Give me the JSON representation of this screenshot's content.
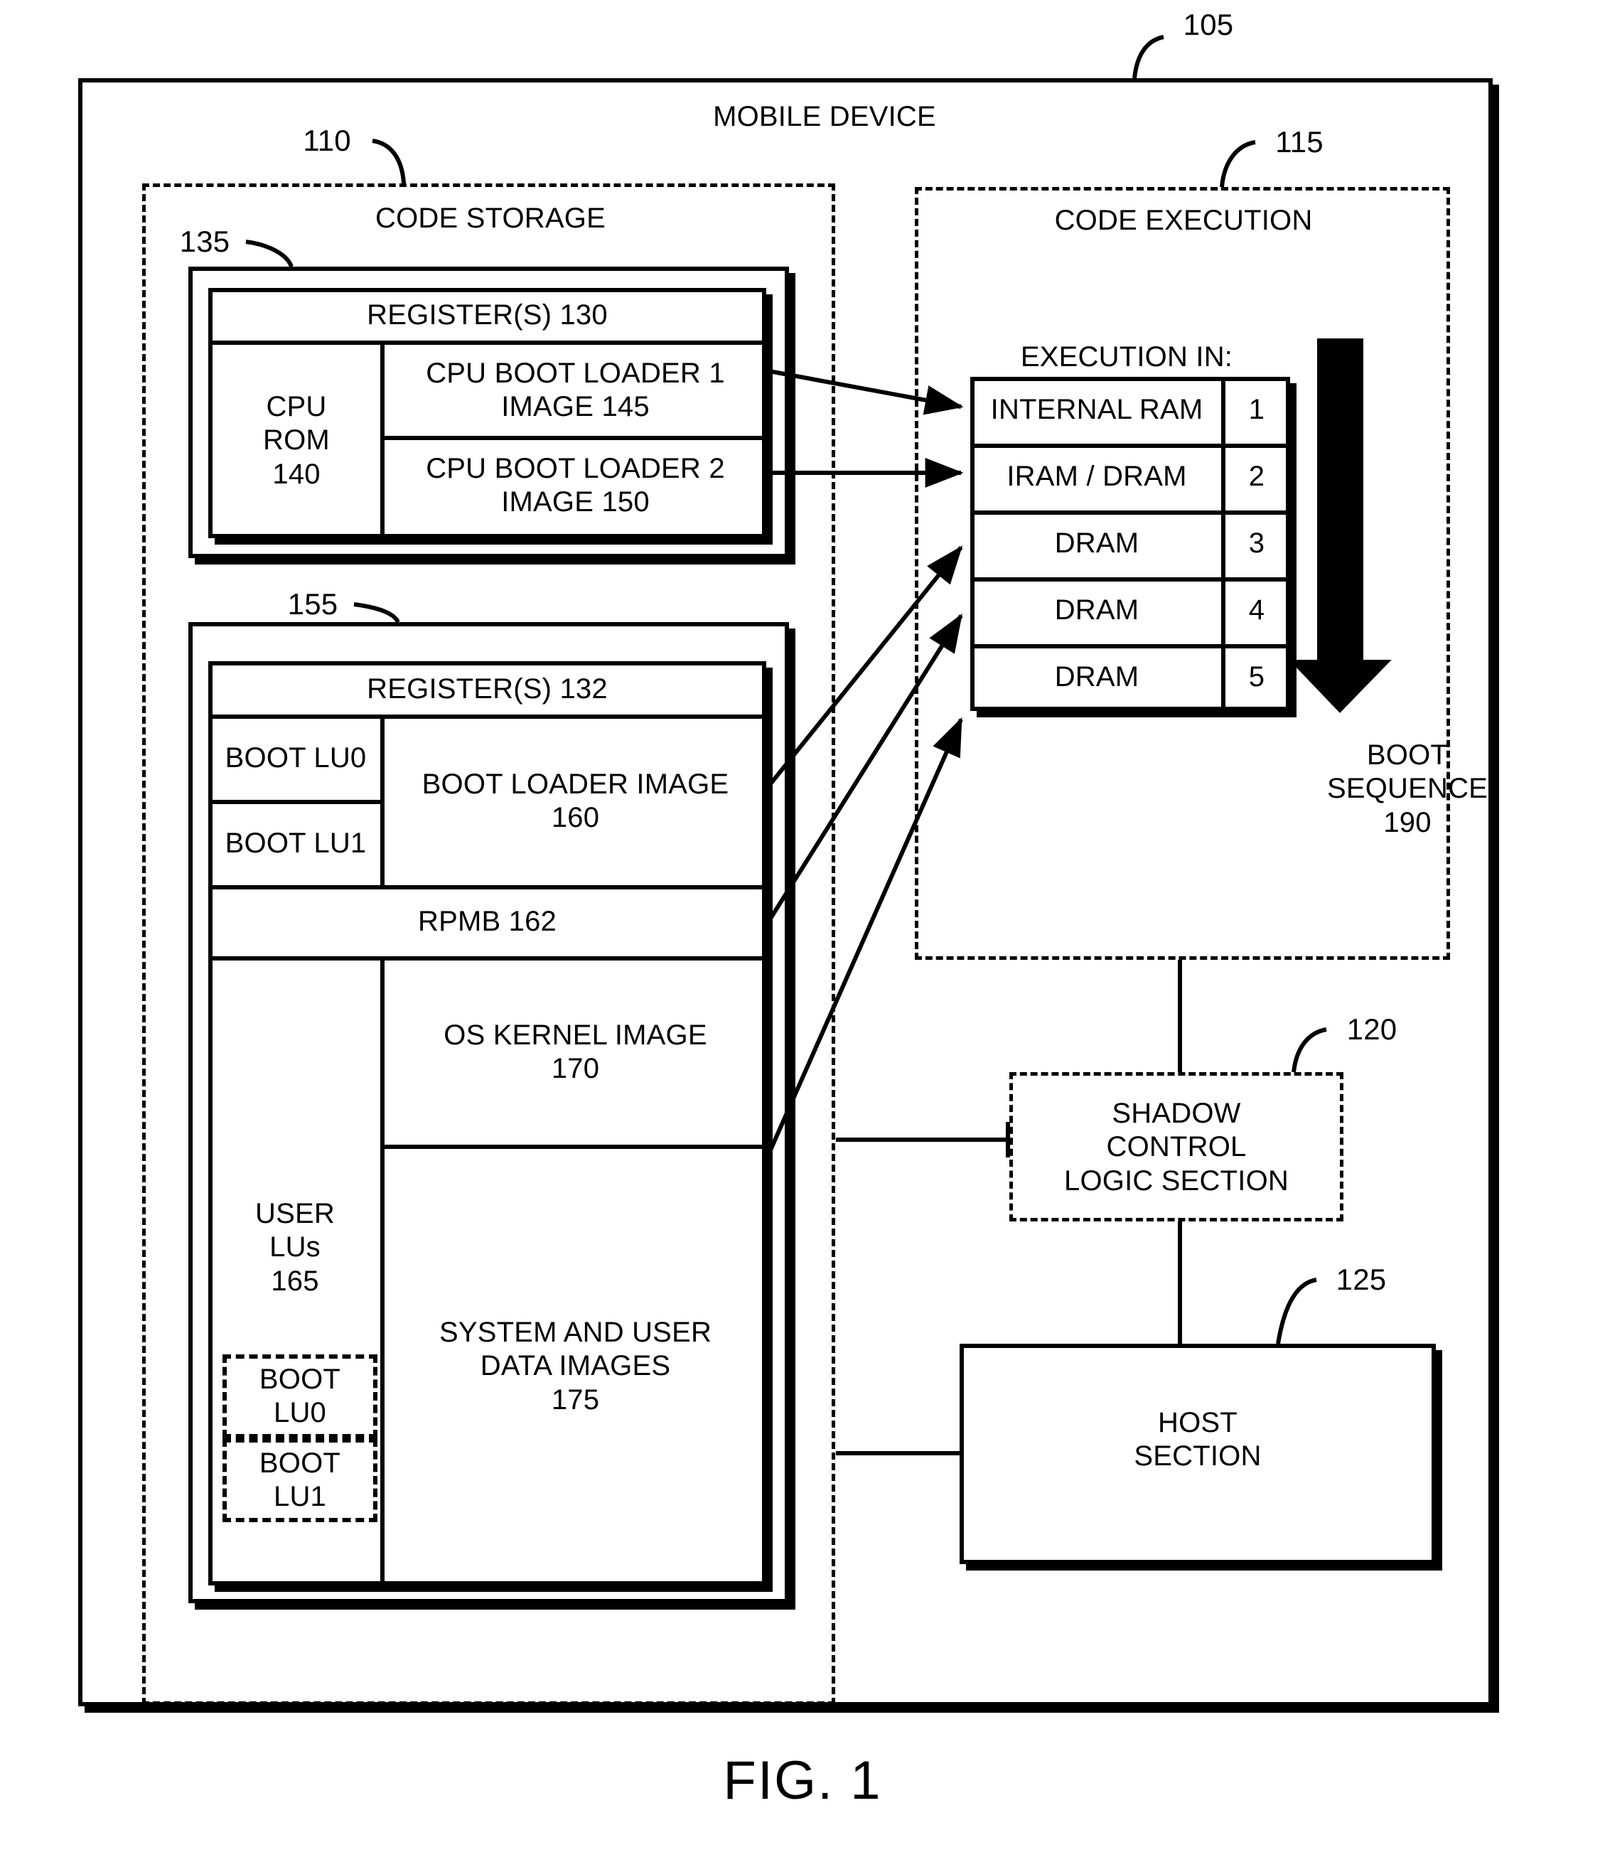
{
  "figure": {
    "caption": "FIG. 1",
    "device_title": "MOBILE DEVICE",
    "device_ref": "105"
  },
  "code_storage": {
    "title": "CODE STORAGE",
    "ref": "110",
    "cpu_block": {
      "ref": "135",
      "registers_label": "REGISTER(S) 130",
      "cpu_rom_label": "CPU\nROM\n140",
      "boot_loader_1": "CPU BOOT LOADER 1\nIMAGE 145",
      "boot_loader_2": "CPU BOOT LOADER 2\nIMAGE 150"
    },
    "storage_block": {
      "ref": "155",
      "registers_label": "REGISTER(S) 132",
      "boot_lu0": "BOOT LU0",
      "boot_lu1": "BOOT LU1",
      "boot_loader_image": "BOOT LOADER IMAGE\n160",
      "rpmb": "RPMB 162",
      "user_lus": "USER\nLUs\n165",
      "user_boot_lu0": "BOOT\nLU0",
      "user_boot_lu1": "BOOT\nLU1",
      "os_kernel_image": "OS KERNEL IMAGE\n170",
      "system_user_data": "SYSTEM AND USER\nDATA IMAGES\n175"
    }
  },
  "code_execution": {
    "title": "CODE EXECUTION",
    "ref": "115",
    "table_caption": "EXECUTION IN:",
    "rows": [
      {
        "location": "INTERNAL RAM",
        "step": "1"
      },
      {
        "location": "IRAM / DRAM",
        "step": "2"
      },
      {
        "location": "DRAM",
        "step": "3"
      },
      {
        "location": "DRAM",
        "step": "4"
      },
      {
        "location": "DRAM",
        "step": "5"
      }
    ],
    "boot_sequence_label": "BOOT\nSEQUENCE\n190"
  },
  "shadow_control": {
    "label": "SHADOW\nCONTROL\nLOGIC SECTION",
    "ref": "120"
  },
  "host": {
    "label": "HOST\nSECTION",
    "ref": "125"
  },
  "colors": {
    "ink": "#000000",
    "paper": "#ffffff"
  }
}
